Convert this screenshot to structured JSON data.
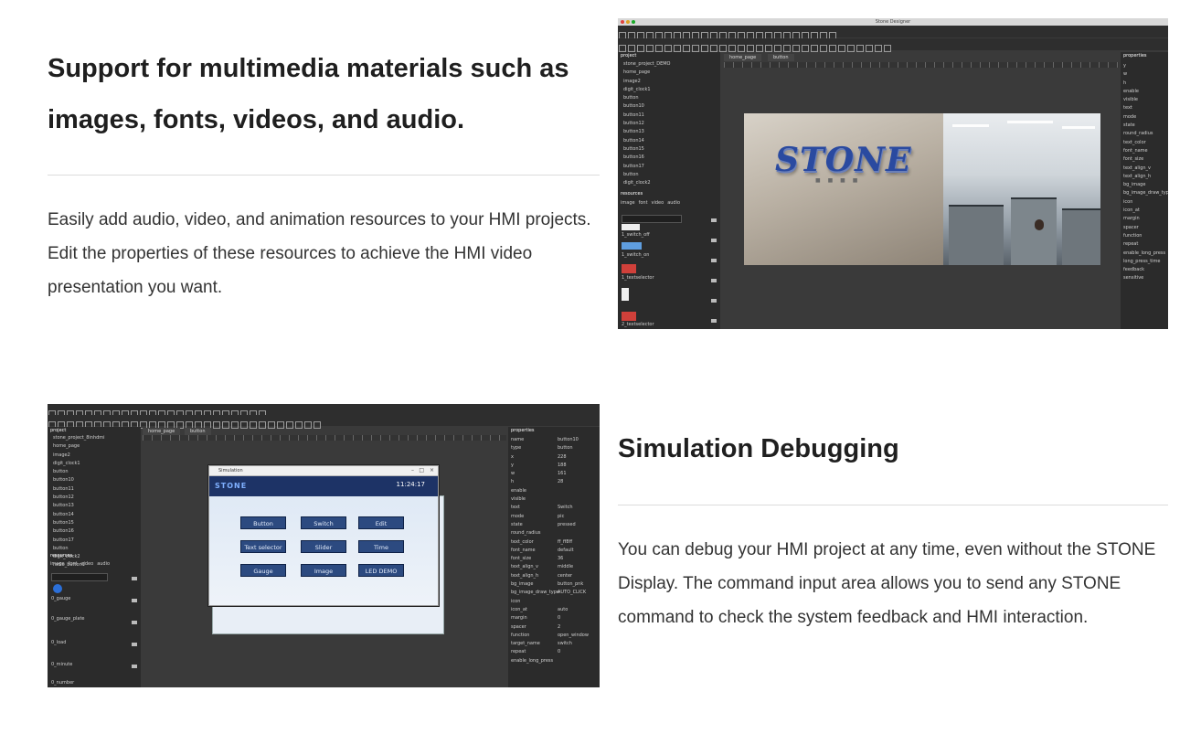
{
  "section1": {
    "title": "Support for multimedia materials such as images, fonts, videos, and audio.",
    "body": "Easily add audio, video, and animation resources to your HMI projects. Edit the properties of these resources to achieve the HMI video presentation you want."
  },
  "section2": {
    "title": "Simulation Debugging",
    "body": "You can debug your HMI project at any time, even without the STONE Display. The command input area allows you to send any STONE command to check the system feedback and HMI interaction."
  },
  "editor1": {
    "window_title": "Stone Designer",
    "project_label": "project",
    "tabs": [
      "home_page",
      "button"
    ],
    "tree": [
      "stone_project_DEMO",
      "home_page",
      "image2",
      "digit_clock1",
      "button",
      "button10",
      "button11",
      "button12",
      "button13",
      "button14",
      "button15",
      "button16",
      "button17",
      "button",
      "digit_clock2"
    ],
    "resources_label": "resources",
    "resource_tabs": [
      "image",
      "font",
      "video",
      "audio"
    ],
    "resource_items": [
      "1_switch_off",
      "1_switch_on",
      "1_textselector",
      "2_textselector"
    ],
    "properties_label": "properties",
    "properties": [
      "y",
      "w",
      "h",
      "enable",
      "visible",
      "text",
      "mode",
      "state",
      "round_radius",
      "text_color",
      "font_name",
      "font_size",
      "text_align_v",
      "text_align_h",
      "bg_image",
      "bg_image_draw_type",
      "icon",
      "icon_at",
      "margin",
      "spacer",
      "function",
      "repeat",
      "enable_long_press",
      "long_press_time",
      "feedback",
      "sensitive"
    ],
    "photo_logo": "STONE"
  },
  "editor2": {
    "project_label": "project",
    "tabs": [
      "home_page",
      "button"
    ],
    "tree": [
      "stone_project_8inhdmi",
      "home_page",
      "image2",
      "digit_clock1",
      "button",
      "button10",
      "button11",
      "button12",
      "button13",
      "button14",
      "button15",
      "button16",
      "button17",
      "button",
      "digit_clock2",
      "radio_button1"
    ],
    "resources_label": "resources",
    "resource_tabs": [
      "image",
      "font",
      "video",
      "audio"
    ],
    "resource_items": [
      "0_gauge",
      "0_gauge_plate",
      "0_load",
      "0_minute",
      "0_number"
    ],
    "properties_label": "properties",
    "properties": [
      "name",
      "type",
      "x",
      "y",
      "w",
      "h",
      "enable",
      "visible",
      "text",
      "mode",
      "state",
      "round_radius",
      "text_color",
      "font_name",
      "font_size",
      "text_align_v",
      "text_align_h",
      "bg_image",
      "bg_image_draw_type",
      "icon",
      "icon_at",
      "margin",
      "spacer",
      "function",
      "target_name",
      "repeat",
      "enable_long_press"
    ],
    "property_values": [
      "button10",
      "button",
      "228",
      "188",
      "161",
      "28",
      "",
      "",
      "Switch",
      "pic",
      "pressed",
      "",
      "ff_ff8ff",
      "default",
      "36",
      "middle",
      "center",
      "button_pnk",
      "AUTO_CLICK",
      "",
      "auto",
      "0",
      "2",
      "open_window",
      "switch",
      "0",
      ""
    ],
    "sim": {
      "window_title": "Simulation",
      "brand": "STONE",
      "time": "11:24:17",
      "buttons": [
        "Button",
        "Switch",
        "Edit",
        "Text selector",
        "Slider",
        "Time",
        "Gauge",
        "Image",
        "LED DEMO"
      ]
    }
  }
}
